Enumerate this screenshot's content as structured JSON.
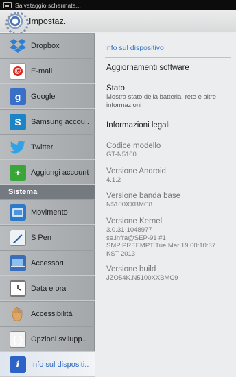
{
  "status_bar": {
    "text": "Salvataggio schermata..."
  },
  "action_bar": {
    "title": "Impostaz."
  },
  "sidebar": {
    "items": [
      {
        "label": "Dropbox",
        "icon": "dropbox-icon"
      },
      {
        "label": "E-mail",
        "icon": "email-icon"
      },
      {
        "label": "Google",
        "icon": "google-icon",
        "glyph": "g"
      },
      {
        "label": "Samsung accou..",
        "icon": "samsung-account-icon",
        "glyph": "S"
      },
      {
        "label": "Twitter",
        "icon": "twitter-icon"
      },
      {
        "label": "Aggiungi account",
        "icon": "add-account-icon",
        "glyph": "+"
      }
    ],
    "section_title": "Sistema",
    "system_items": [
      {
        "label": "Movimento",
        "icon": "motion-icon"
      },
      {
        "label": "S Pen",
        "icon": "spen-icon"
      },
      {
        "label": "Accessori",
        "icon": "accessories-icon"
      },
      {
        "label": "Data e ora",
        "icon": "clock-icon"
      },
      {
        "label": "Accessibilità",
        "icon": "hand-icon"
      },
      {
        "label": "Opzioni svilupp..",
        "icon": "developer-options-icon",
        "glyph": "{ }"
      },
      {
        "label": "Info sul dispositi..",
        "icon": "info-icon",
        "glyph": "i"
      }
    ]
  },
  "detail": {
    "header": "Info sul dispositivo",
    "rows": [
      {
        "title": "Aggiornamenti software"
      },
      {
        "title": "Stato",
        "subtitle": "Mostra stato della batteria, rete e altre informazioni"
      },
      {
        "title": "Informazioni legali"
      },
      {
        "title": "Codice modello",
        "subtitle": "GT-N5100"
      },
      {
        "title": "Versione Android",
        "subtitle": "4.1.2"
      },
      {
        "title": "Versione banda base",
        "subtitle": "N5100XXBMC8"
      },
      {
        "title": "Versione Kernel",
        "subtitle_lines": [
          "3.0.31-1048977",
          "se.infra@SEP-91 #1",
          "SMP PREEMPT Tue Mar 19 00:10:37",
          "KST 2013"
        ]
      },
      {
        "title": "Versione build",
        "subtitle": "JZO54K.N5100XXBMC9"
      }
    ]
  },
  "colors": {
    "accent": "#3a77c4",
    "section_header": "#747a80",
    "sidebar": "#b0b3b6"
  }
}
